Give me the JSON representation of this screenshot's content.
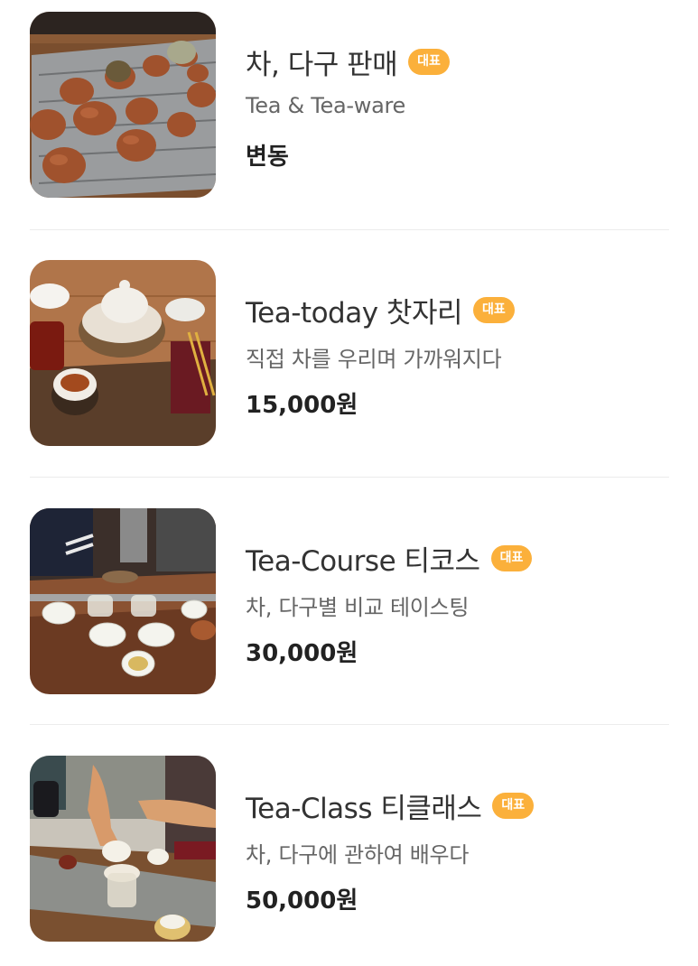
{
  "accent_color": "#FBB03B",
  "products": [
    {
      "title": "차, 다구 판매",
      "badge": "대표",
      "subtitle": "Tea & Tea-ware",
      "price": "변동",
      "image_icon": "teapots-photo"
    },
    {
      "title": "Tea-today 찻자리",
      "badge": "대표",
      "subtitle": "직접 차를 우리며 가까워지다",
      "price": "15,000원",
      "image_icon": "tea-table-photo"
    },
    {
      "title": "Tea-Course 티코스",
      "badge": "대표",
      "subtitle": "차, 다구별 비교 테이스팅",
      "price": "30,000원",
      "image_icon": "tasting-set-photo"
    },
    {
      "title": "Tea-Class 티클래스",
      "badge": "대표",
      "subtitle": "차, 다구에 관하여 배우다",
      "price": "50,000원",
      "image_icon": "pouring-class-photo"
    }
  ]
}
